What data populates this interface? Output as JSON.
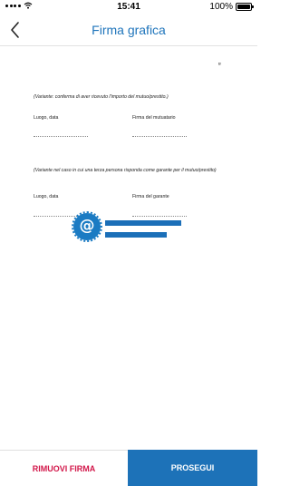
{
  "status_bar": {
    "carrier_icons": [
      "signal-dots-icon",
      "wifi-icon"
    ],
    "time": "15:41",
    "battery_percent": "100%"
  },
  "nav": {
    "back_icon": "chevron-left-icon",
    "title": "Firma grafica"
  },
  "document": {
    "corner_mark": "ɐ",
    "section1": {
      "note": "(Variante: conferma di aver ricevuto l'importo del mutuo/prestito.)",
      "place_date_label": "Luogo, data",
      "signature_label": "Firma del mutuatario"
    },
    "section2": {
      "note": "(Variante nel caso in cui una terza persona risponda come garante per il mutuo/prestito)",
      "place_date_label": "Luogo, data",
      "signature_label": "Firma del garante"
    },
    "signature_stamp": {
      "symbol": "@",
      "color": "#1b7bc3"
    }
  },
  "footer": {
    "remove_label": "RIMUOVI FIRMA",
    "continue_label": "PROSEGUI",
    "remove_color": "#d2174a",
    "continue_bg": "#1d72b8"
  }
}
